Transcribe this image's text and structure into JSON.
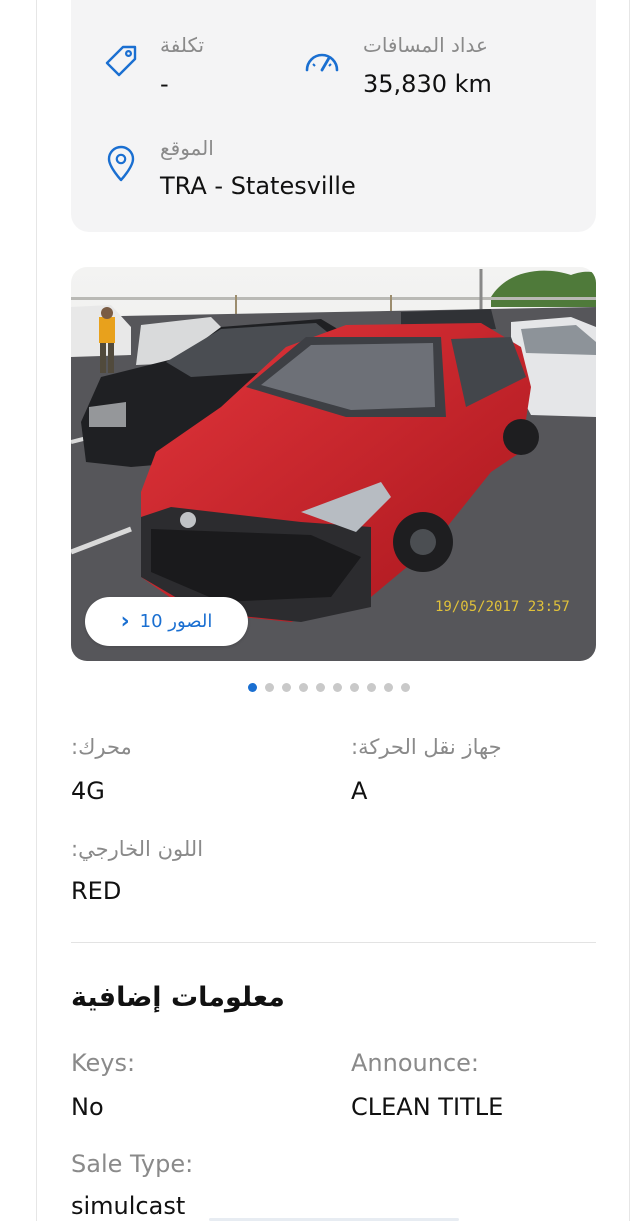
{
  "info_card": {
    "cost": {
      "label": "تكلفة",
      "value": "-",
      "icon": "price-tag-icon"
    },
    "mileage": {
      "label": "عداد المسافات",
      "value": "35,830 km",
      "icon": "speedometer-icon"
    },
    "location": {
      "label": "الموقع",
      "value": "TRA - Statesville",
      "icon": "location-pin-icon"
    }
  },
  "photo": {
    "timestamp": "19/05/2017 23:57",
    "button_label": "الصور 10",
    "button_icon": "chevron-right-icon",
    "dot_count": 10,
    "active_dot": 0
  },
  "specs": {
    "engine": {
      "label": ":محرك",
      "value": "4G"
    },
    "transmission": {
      "label": ":جهاز نقل الحركة",
      "value": "A"
    },
    "exterior_color": {
      "label": ":اللون الخارجي",
      "value": "RED"
    }
  },
  "additional": {
    "title": "معلومات إضافية",
    "keys": {
      "label": "Keys:",
      "value": "No"
    },
    "announce": {
      "label": "Announce:",
      "value": "CLEAN TITLE"
    },
    "sale_type": {
      "label": "Sale Type:",
      "value": "simulcast"
    }
  },
  "colors": {
    "accent": "#1a6fd1",
    "muted_text": "#8a8a8a",
    "card_bg": "#f4f4f5"
  }
}
